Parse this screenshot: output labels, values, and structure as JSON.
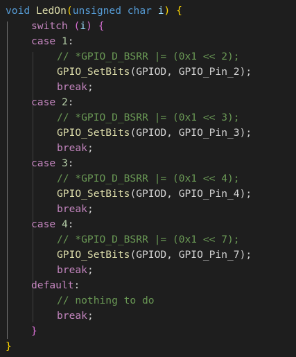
{
  "code": {
    "func_sig": {
      "ret_type": "void",
      "name": "LedOn",
      "paren_open": "(",
      "param_type": "unsigned char",
      "param_name": "i",
      "paren_close": ")",
      "brace_open": "{"
    },
    "switch_stmt": {
      "keyword": "switch",
      "paren_open": "(",
      "arg": "i",
      "paren_close": ")",
      "brace_open": "{"
    },
    "cases": [
      {
        "keyword": "case",
        "value": "1",
        "colon": ":",
        "comment": "// *GPIO_D_BSRR |= (0x1 << 2);",
        "call_name": "GPIO_SetBits",
        "call_args": "(GPIOD, GPIO_Pin_2);",
        "break_kw": "break",
        "semi": ";"
      },
      {
        "keyword": "case",
        "value": "2",
        "colon": ":",
        "comment": "// *GPIO_D_BSRR |= (0x1 << 3);",
        "call_name": "GPIO_SetBits",
        "call_args": "(GPIOD, GPIO_Pin_3);",
        "break_kw": "break",
        "semi": ";"
      },
      {
        "keyword": "case",
        "value": "3",
        "colon": ":",
        "comment": "// *GPIO_D_BSRR |= (0x1 << 4);",
        "call_name": "GPIO_SetBits",
        "call_args": "(GPIOD, GPIO_Pin_4);",
        "break_kw": "break",
        "semi": ";"
      },
      {
        "keyword": "case",
        "value": "4",
        "colon": ":",
        "comment": "// *GPIO_D_BSRR |= (0x1 << 7);",
        "call_name": "GPIO_SetBits",
        "call_args": "(GPIOD, GPIO_Pin_7);",
        "break_kw": "break",
        "semi": ";"
      }
    ],
    "default_case": {
      "keyword": "default",
      "colon": ":",
      "comment": "// nothing to do",
      "break_kw": "break",
      "semi": ";"
    },
    "switch_close": "}",
    "func_close": "}"
  },
  "theme": {
    "background": "#1e1e1e",
    "keyword": "#569cd6",
    "control": "#c586c0",
    "function": "#dcdcaa",
    "variable": "#9cdcfe",
    "number": "#b5cea8",
    "comment": "#6a9955",
    "bracket_level_1": "#ffd700",
    "bracket_level_2": "#da70d6"
  }
}
